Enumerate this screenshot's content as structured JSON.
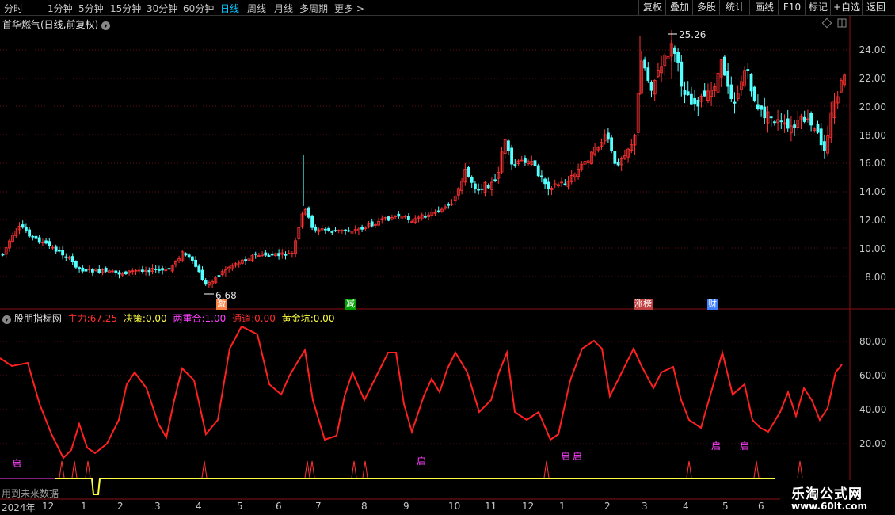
{
  "toolbar": {
    "periods": [
      "分时",
      "1分钟",
      "5分钟",
      "15分钟",
      "30分钟",
      "60分钟",
      "日线",
      "周线",
      "月线",
      "多周期",
      "更多 >"
    ],
    "active_period": "日线",
    "buttons": [
      "复权",
      "叠加",
      "多股",
      "统计",
      "画线",
      "F10",
      "标记",
      "+自选",
      "返回"
    ]
  },
  "main": {
    "title": "首华燃气(日线,前复权)",
    "price_labels": [
      "24.00",
      "22.00",
      "20.00",
      "18.00",
      "16.00",
      "14.00",
      "12.00",
      "10.00",
      "8.00"
    ],
    "high_label": "25.26",
    "low_label": "6.68",
    "event_tags": [
      {
        "text": "激",
        "color": "#ff8040"
      },
      {
        "text": "减",
        "color": "#00a000"
      },
      {
        "text": "涨榜",
        "color": "#c04040"
      },
      {
        "text": "财",
        "color": "#4080ff"
      }
    ]
  },
  "indicator": {
    "name": "股朋指标网",
    "items": [
      {
        "label": "主力:",
        "value": "67.25",
        "color": "#ff3030"
      },
      {
        "label": "决策:",
        "value": "0.00",
        "color": "#ffff40"
      },
      {
        "label": "两重合:",
        "value": "1.00",
        "color": "#ff40ff"
      },
      {
        "label": "通道:",
        "value": "0.00",
        "color": "#ff3030"
      },
      {
        "label": "黄金坑:",
        "value": "0.00",
        "color": "#ffff40"
      }
    ],
    "axis_labels": [
      "80.00",
      "60.00",
      "40.00",
      "20.00"
    ],
    "qi_label": "启",
    "footer_text": "用到未来数据"
  },
  "bottom_axis": {
    "labels": [
      "2024年",
      "12",
      "1",
      "2",
      "3",
      "4",
      "5",
      "6",
      "7",
      "8",
      "9",
      "10",
      "11",
      "12",
      "1",
      "2",
      "3",
      "4",
      "5",
      "6"
    ]
  },
  "watermark": {
    "title": "乐淘公式网",
    "url": "www.60lt.com"
  },
  "colors": {
    "up": "#ff3232",
    "down": "#54ffff",
    "main_line": "#ff2020",
    "signal_line": "#ffff40",
    "spike": "#ff3232"
  }
}
